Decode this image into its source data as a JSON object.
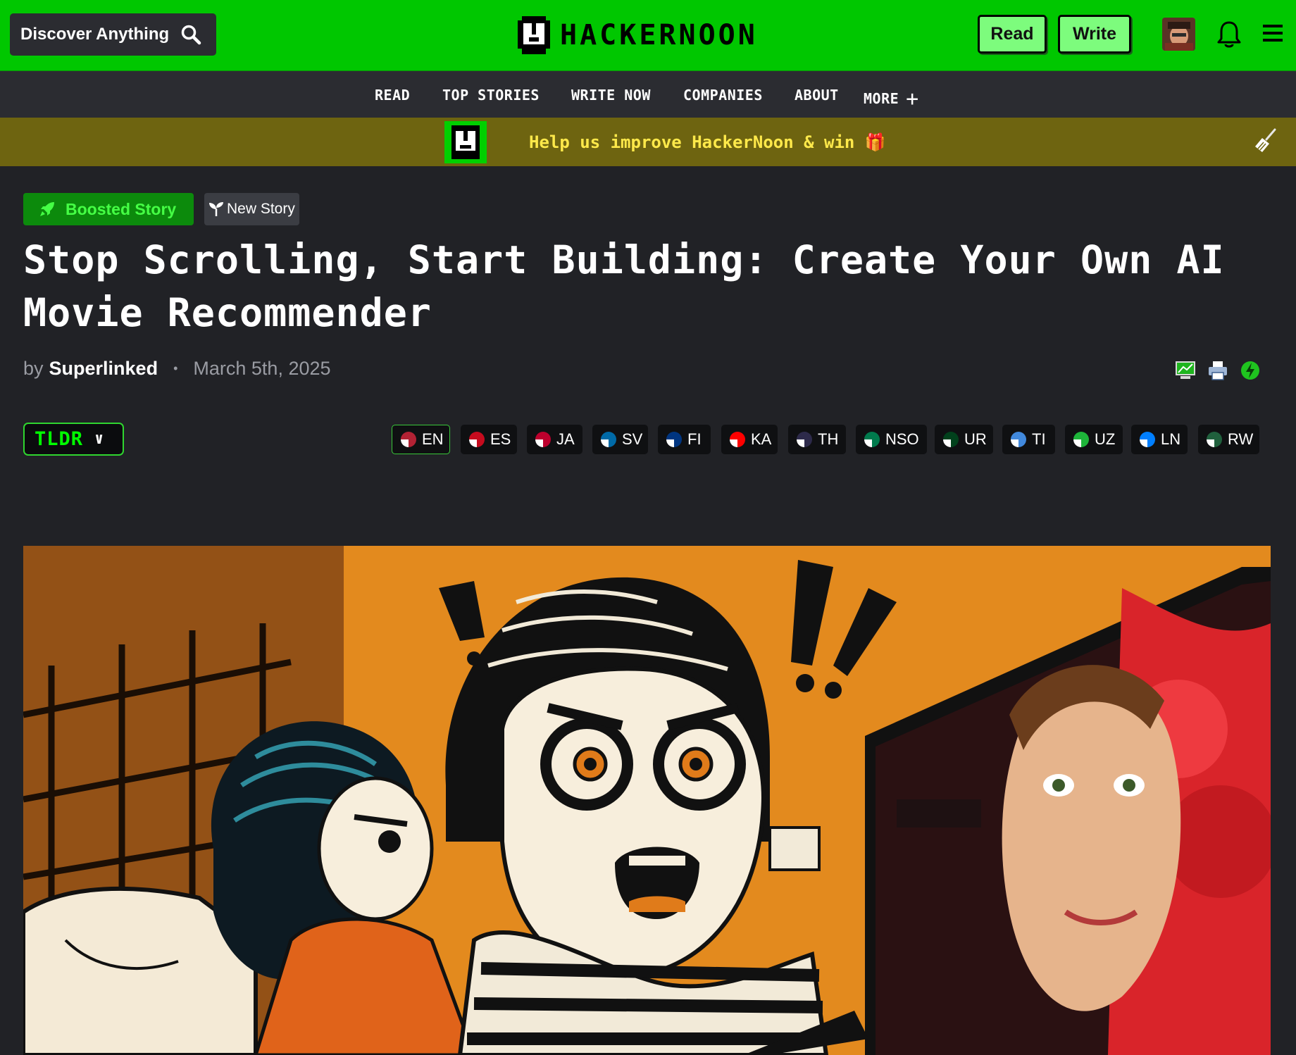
{
  "header": {
    "search_label": "Discover Anything",
    "logo_text": "HACKERNOON",
    "read_button": "Read",
    "write_button": "Write"
  },
  "subnav": {
    "items": [
      "READ",
      "TOP STORIES",
      "WRITE NOW",
      "COMPANIES",
      "ABOUT",
      "MORE"
    ]
  },
  "promo": {
    "text": "Help us improve HackerNoon & win 🎁"
  },
  "article": {
    "tags": {
      "boosted": "Boosted Story",
      "new": "New Story"
    },
    "title": "Stop Scrolling, Start Building: Create Your Own AI Movie Recommender",
    "by_label": "by",
    "author": "Superlinked",
    "date": "March 5th, 2025",
    "tldr_label": "TLDR",
    "languages": [
      {
        "code": "EN",
        "flag_color": "#b22234",
        "active": true
      },
      {
        "code": "ES",
        "flag_color": "#c60b1e",
        "active": false
      },
      {
        "code": "JA",
        "flag_color": "#bc002d",
        "active": false
      },
      {
        "code": "SV",
        "flag_color": "#006aa7",
        "active": false
      },
      {
        "code": "FI",
        "flag_color": "#003580",
        "active": false
      },
      {
        "code": "KA",
        "flag_color": "#ff0000",
        "active": false
      },
      {
        "code": "TH",
        "flag_color": "#2d2a4a",
        "active": false
      },
      {
        "code": "NSO",
        "flag_color": "#007a4d",
        "active": false
      },
      {
        "code": "UR",
        "flag_color": "#01411c",
        "active": false
      },
      {
        "code": "TI",
        "flag_color": "#4189dd",
        "active": false
      },
      {
        "code": "UZ",
        "flag_color": "#1eb53a",
        "active": false
      },
      {
        "code": "LN",
        "flag_color": "#007fff",
        "active": false
      },
      {
        "code": "RW",
        "flag_color": "#20603d",
        "active": false
      }
    ]
  },
  "colors": {
    "brand_green": "#00c700",
    "button_green": "#7dfc7d",
    "background": "#212226",
    "promo_bg": "#6e6410",
    "promo_text": "#ffe94a"
  }
}
